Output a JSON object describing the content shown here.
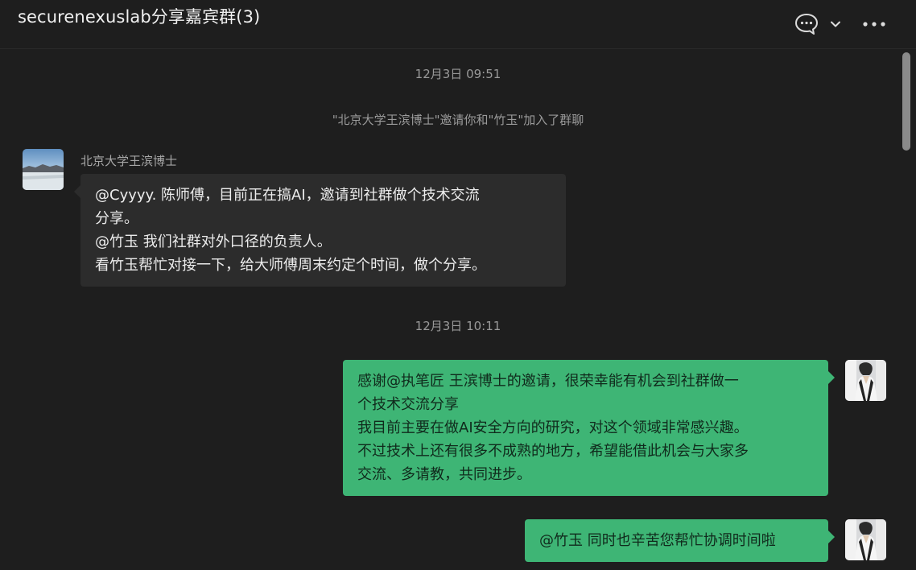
{
  "header": {
    "title": "securenexuslab分享嘉宾群(3)",
    "chat_info_icon": "speech-bubble-icon",
    "dropdown_icon": "chevron-down-icon",
    "more_icon": "more-dots-icon"
  },
  "messages": {
    "timestamp_1": "12月3日 09:51",
    "system_notice": "\"北京大学王滨博士\"邀请你和\"竹玉\"加入了群聊",
    "msg1": {
      "sender": "北京大学王滨博士",
      "lines": [
        "@Cyyyy. 陈师傅，目前正在搞AI，邀请到社群做个技术交流",
        "分享。",
        "@竹玉 我们社群对外口径的负责人。",
        "看竹玉帮忙对接一下，给大师傅周末约定个时间，做个分享。"
      ]
    },
    "timestamp_2": "12月3日 10:11",
    "msg2": {
      "lines": [
        "感谢@执笔匠 王滨博士的邀请，很荣幸能有机会到社群做一",
        "个技术交流分享",
        "我目前主要在做AI安全方向的研究，对这个领域非常感兴趣。",
        "不过技术上还有很多不成熟的地方，希望能借此机会与大家多",
        "交流、多请教，共同进步。"
      ]
    },
    "msg3": {
      "lines": [
        "@竹玉 同时也辛苦您帮忙协调时间啦"
      ]
    }
  },
  "colors": {
    "background": "#1e1e1e",
    "incoming_bubble": "#2c2c2c",
    "outgoing_bubble": "#3eb575",
    "muted_text": "#9a9a9a"
  }
}
